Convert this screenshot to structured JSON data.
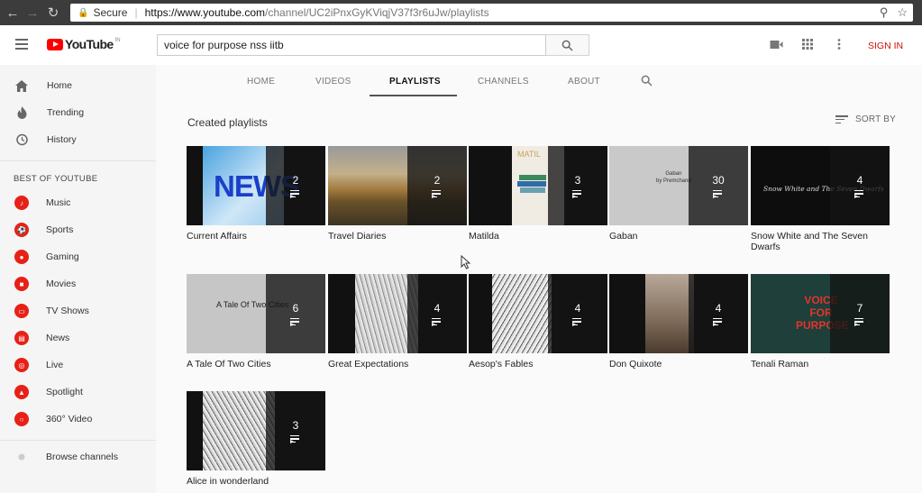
{
  "browser": {
    "secure_label": "Secure",
    "url_host": "https://www.youtube.com",
    "url_path": "/channel/UC2iPnxGyKViqjV37f3r6uJw/playlists"
  },
  "header": {
    "logo_text": "YouTube",
    "logo_sup": "IN",
    "search_value": "voice for purpose nss iitb",
    "signin_label": "SIGN IN",
    "brand_color": "#ff0000",
    "signin_color": "#cc1100"
  },
  "sidebar": {
    "top_items": [
      {
        "label": "Home",
        "icon": "home-icon"
      },
      {
        "label": "Trending",
        "icon": "flame-icon"
      },
      {
        "label": "History",
        "icon": "history-icon"
      }
    ],
    "section_title": "BEST OF YOUTUBE",
    "best_items": [
      {
        "label": "Music",
        "icon": "music-icon"
      },
      {
        "label": "Sports",
        "icon": "sports-icon"
      },
      {
        "label": "Gaming",
        "icon": "gaming-icon"
      },
      {
        "label": "Movies",
        "icon": "movies-icon"
      },
      {
        "label": "TV Shows",
        "icon": "tv-icon"
      },
      {
        "label": "News",
        "icon": "news-icon"
      },
      {
        "label": "Live",
        "icon": "live-icon"
      },
      {
        "label": "Spotlight",
        "icon": "spotlight-icon"
      },
      {
        "label": "360° Video",
        "icon": "360-video-icon"
      }
    ],
    "browse_label": "Browse channels"
  },
  "tabs": [
    {
      "label": "HOME"
    },
    {
      "label": "VIDEOS"
    },
    {
      "label": "PLAYLISTS",
      "active": true
    },
    {
      "label": "CHANNELS"
    },
    {
      "label": "ABOUT"
    }
  ],
  "main": {
    "section_title": "Created playlists",
    "sort_label": "SORT BY"
  },
  "playlists": [
    {
      "title": "Current Affairs",
      "count": "2",
      "thumb_text": "NEWS"
    },
    {
      "title": "Travel Diaries",
      "count": "2",
      "thumb_text": ""
    },
    {
      "title": "Matilda",
      "count": "3",
      "thumb_text": "MATIL"
    },
    {
      "title": "Gaban",
      "count": "30",
      "thumb_text": "Gaban\nby Premchand"
    },
    {
      "title": "Snow White and The Seven Dwarfs",
      "count": "4",
      "thumb_text": "Snow White and The Seven Dwarfs"
    },
    {
      "title": "A Tale Of Two Cities",
      "count": "6",
      "thumb_text": "A Tale Of Two Cities"
    },
    {
      "title": "Great Expectations",
      "count": "4",
      "thumb_text": ""
    },
    {
      "title": "Aesop's Fables",
      "count": "4",
      "thumb_text": ""
    },
    {
      "title": "Don Quixote",
      "count": "4",
      "thumb_text": ""
    },
    {
      "title": "Tenali Raman",
      "count": "7",
      "thumb_text": "VOICE FOR PURPOSE"
    },
    {
      "title": "Alice in wonderland",
      "count": "3",
      "thumb_text": ""
    }
  ]
}
